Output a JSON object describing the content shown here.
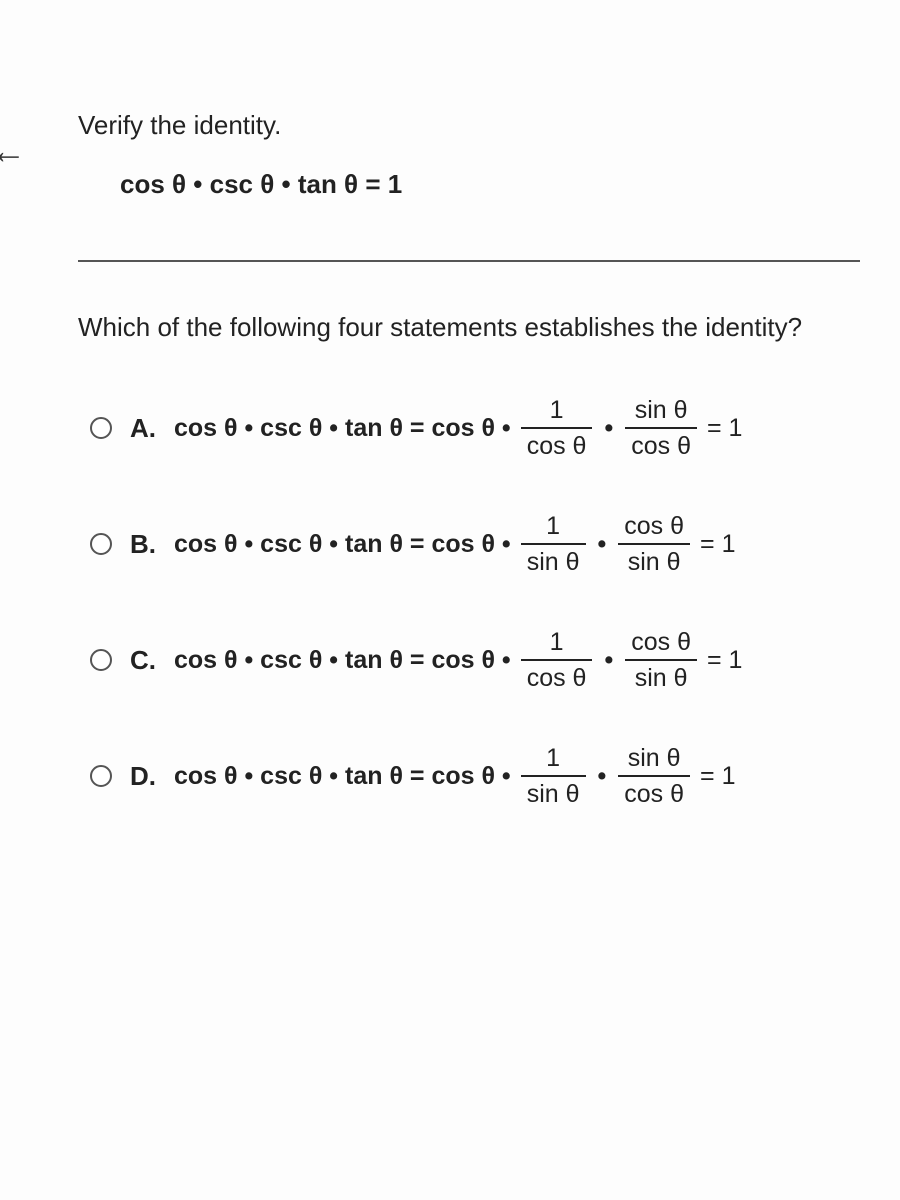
{
  "nav": {
    "back_glyph": "←"
  },
  "prompt": "Verify the identity.",
  "identity": "cos θ • csc θ • tan θ = 1",
  "question": "Which of the following four statements establishes the identity?",
  "lhs": "cos θ • csc θ • tan θ = cos θ •",
  "dot": "•",
  "rhs": "= 1",
  "options": [
    {
      "letter": "A.",
      "f1_num": "1",
      "f1_den": "cos θ",
      "f2_num": "sin θ",
      "f2_den": "cos θ"
    },
    {
      "letter": "B.",
      "f1_num": "1",
      "f1_den": "sin θ",
      "f2_num": "cos θ",
      "f2_den": "sin θ"
    },
    {
      "letter": "C.",
      "f1_num": "1",
      "f1_den": "cos θ",
      "f2_num": "cos θ",
      "f2_den": "sin θ"
    },
    {
      "letter": "D.",
      "f1_num": "1",
      "f1_den": "sin θ",
      "f2_num": "sin θ",
      "f2_den": "cos θ"
    }
  ]
}
